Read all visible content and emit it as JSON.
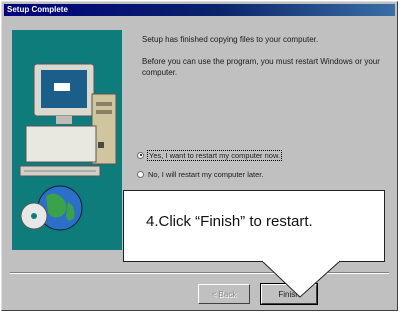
{
  "window": {
    "title": "Setup Complete"
  },
  "messages": {
    "finished": "Setup has finished copying files to your computer.",
    "restart_notice": "Before you can use the program, you must restart Windows or your computer."
  },
  "options": [
    {
      "label": "Yes, I want to restart my computer now.",
      "selected": true
    },
    {
      "label": "No, I will restart my computer later.",
      "selected": false
    }
  ],
  "buttons": {
    "back": "< Back",
    "finish": "Finish"
  },
  "annotation": {
    "text": "4.Click “Finish” to restart."
  },
  "colors": {
    "titlebar": "#0a246a",
    "art_background": "#0f7c7c",
    "dialog_face": "#c0c0c0"
  }
}
